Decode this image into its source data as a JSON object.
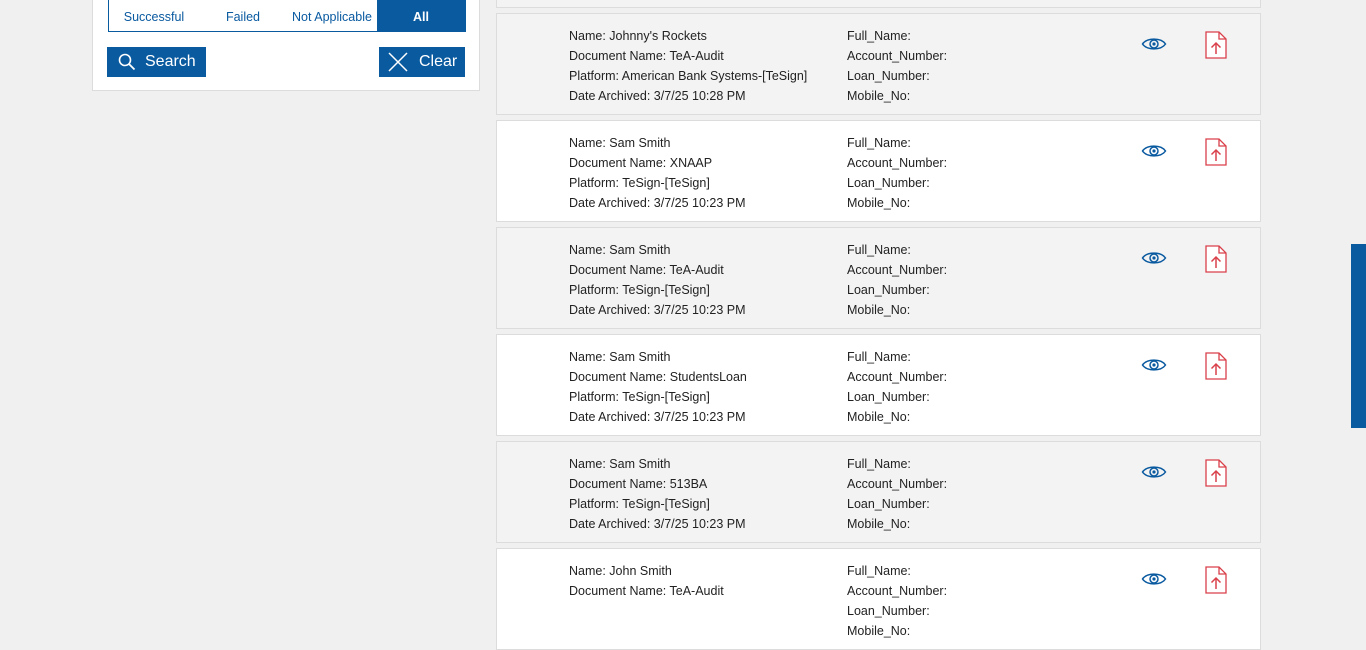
{
  "filters": {
    "status_tabs": [
      {
        "label": "Successful",
        "active": false
      },
      {
        "label": "Failed",
        "active": false
      },
      {
        "label": "Not Applicable",
        "active": false
      },
      {
        "label": "All",
        "active": true
      }
    ],
    "search_label": "Search",
    "clear_label": "Clear"
  },
  "field_labels": {
    "full_name": "Full_Name:",
    "account_number": "Account_Number:",
    "loan_number": "Loan_Number:",
    "mobile_no": "Mobile_No:"
  },
  "records": [
    {
      "name": "Name: Johnny's Rockets",
      "document": "Document Name: TeA-Audit",
      "platform": "Platform: American Bank Systems-[TeSign]",
      "date": "Date Archived: 3/7/25 10:28 PM"
    },
    {
      "name": "Name: Sam Smith",
      "document": "Document Name: XNAAP",
      "platform": "Platform: TeSign-[TeSign]",
      "date": "Date Archived: 3/7/25 10:23 PM"
    },
    {
      "name": "Name: Sam Smith",
      "document": "Document Name: TeA-Audit",
      "platform": "Platform: TeSign-[TeSign]",
      "date": "Date Archived: 3/7/25 10:23 PM"
    },
    {
      "name": "Name: Sam Smith",
      "document": "Document Name: StudentsLoan",
      "platform": "Platform: TeSign-[TeSign]",
      "date": "Date Archived: 3/7/25 10:23 PM"
    },
    {
      "name": "Name: Sam Smith",
      "document": "Document Name: 513BA",
      "platform": "Platform: TeSign-[TeSign]",
      "date": "Date Archived: 3/7/25 10:23 PM"
    },
    {
      "name": "Name: John Smith",
      "document": "Document Name: TeA-Audit",
      "platform": "",
      "date": ""
    }
  ],
  "icons": {
    "view": "eye-icon",
    "pdf": "pdf-file-icon",
    "search": "search-icon",
    "clear": "close-icon"
  },
  "colors": {
    "accent": "#0a5aa0",
    "pdf_red": "#d9404a",
    "page_bg": "#f0f0f0"
  }
}
